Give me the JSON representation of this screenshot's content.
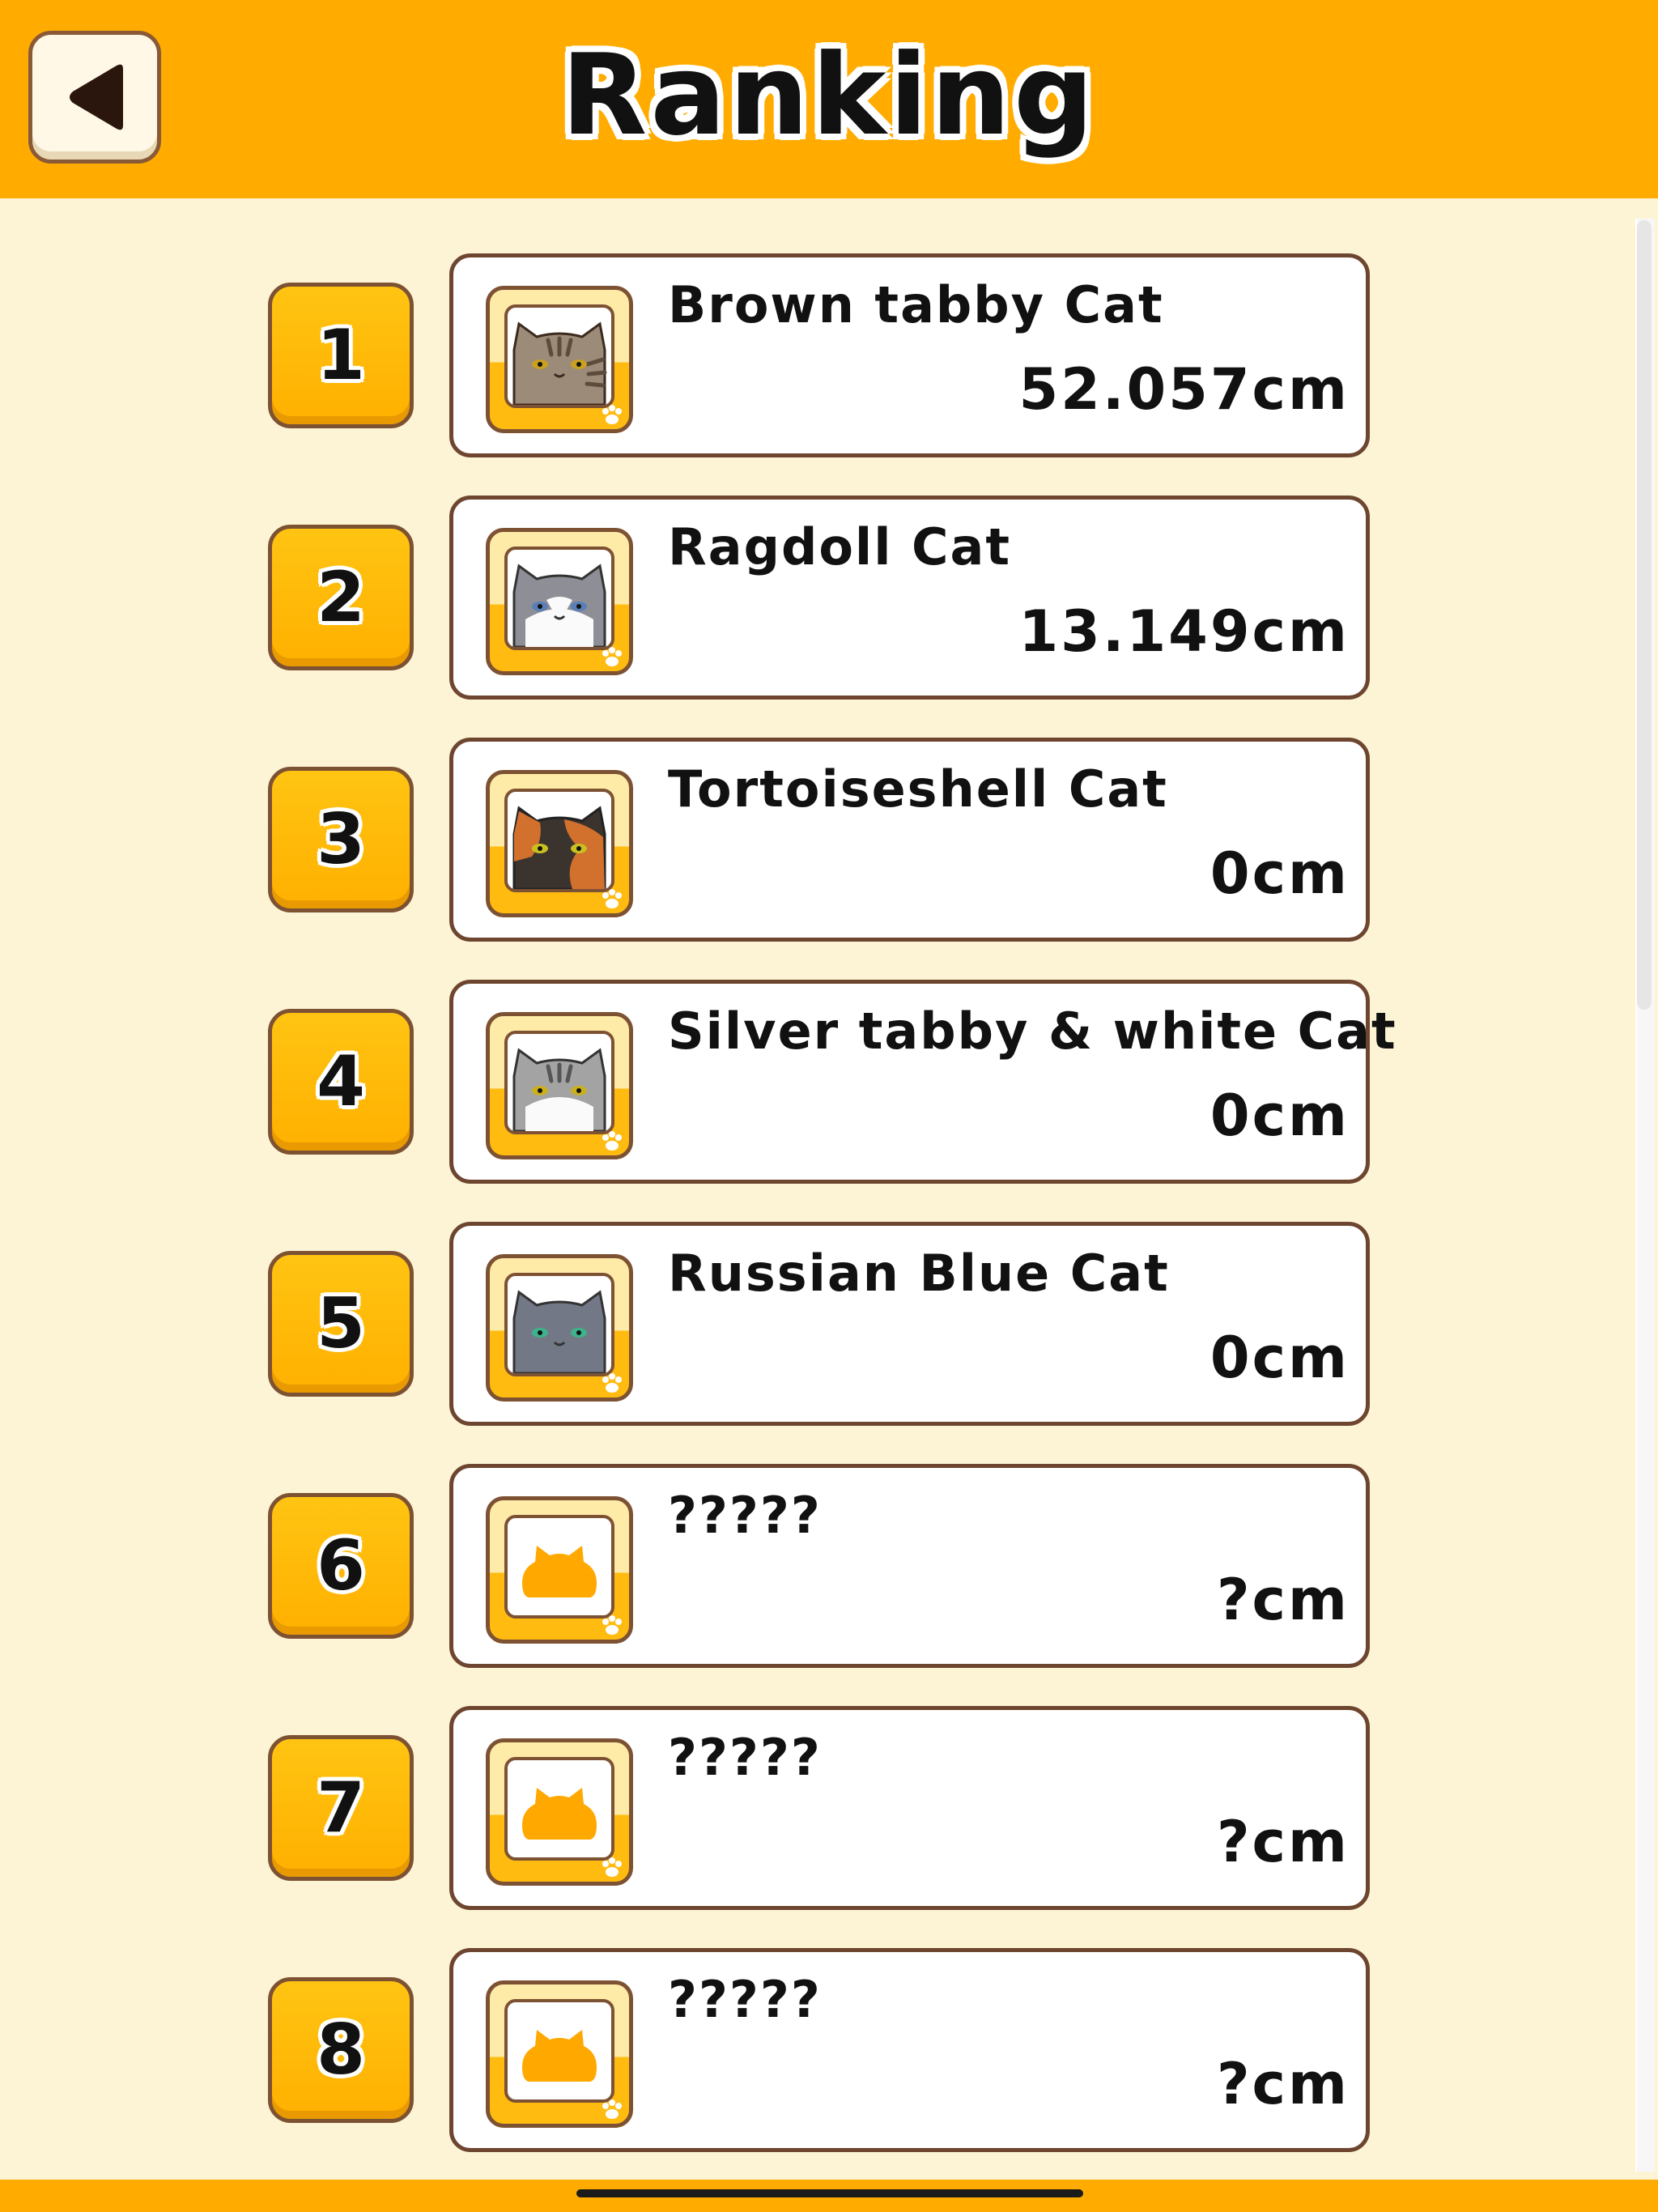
{
  "header": {
    "title": "Ranking",
    "back_icon": "back-arrow-icon"
  },
  "ranking": [
    {
      "rank": "1",
      "name": "Brown tabby Cat",
      "size": "52.057cm",
      "cat": "brown-tabby",
      "unlocked": true
    },
    {
      "rank": "2",
      "name": "Ragdoll Cat",
      "size": "13.149cm",
      "cat": "ragdoll",
      "unlocked": true
    },
    {
      "rank": "3",
      "name": "Tortoiseshell Cat",
      "size": "0cm",
      "cat": "tortoiseshell",
      "unlocked": true
    },
    {
      "rank": "4",
      "name": "Silver tabby & white Cat",
      "size": "0cm",
      "cat": "silver-tabby-white",
      "unlocked": true
    },
    {
      "rank": "5",
      "name": "Russian Blue Cat",
      "size": "0cm",
      "cat": "russian-blue",
      "unlocked": true
    },
    {
      "rank": "6",
      "name": "?????",
      "size": "?cm",
      "cat": "locked",
      "unlocked": false
    },
    {
      "rank": "7",
      "name": "?????",
      "size": "?cm",
      "cat": "locked",
      "unlocked": false
    },
    {
      "rank": "8",
      "name": "?????",
      "size": "?cm",
      "cat": "locked",
      "unlocked": false
    }
  ],
  "colors": {
    "header": "#ffab00",
    "background": "#fdf4d6",
    "badge": "#ffb000",
    "border": "#7d5233",
    "locked_cat": "#ffa800"
  }
}
